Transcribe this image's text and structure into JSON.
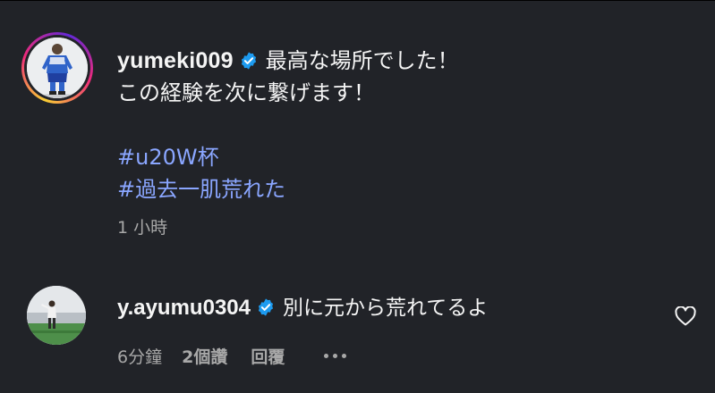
{
  "post": {
    "username": "yumeki009",
    "verified_icon": "verified-badge-icon",
    "caption_line1": "最高な場所でした！",
    "caption_line2": "この経験を次に繋げます！",
    "hashtags": [
      "#u20W杯",
      "#過去一肌荒れた"
    ],
    "timestamp": "1 小時"
  },
  "reply": {
    "username": "y.ayumu0304",
    "verified_icon": "verified-badge-icon",
    "text": "別に元から荒れてるよ",
    "time": "6分鐘",
    "likes": "2個讚",
    "reply_label": "回覆",
    "more_icon": "more-options-icon",
    "like_icon": "heart-outline-icon"
  },
  "colors": {
    "background": "#212328",
    "text": "#f5f5f5",
    "muted": "#a8a8a8",
    "hashtag": "#8aa6ff",
    "verified": "#1d9bf0"
  }
}
